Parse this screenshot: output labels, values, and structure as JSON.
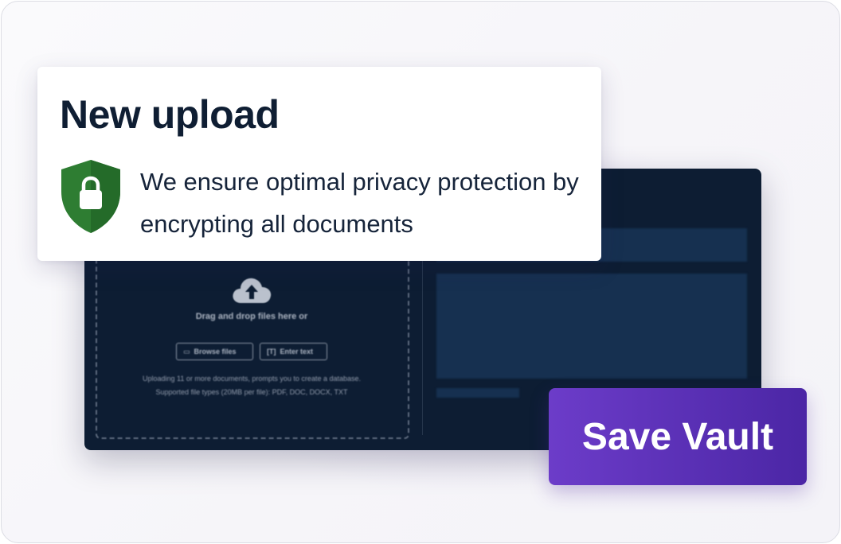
{
  "card": {
    "title": "New upload",
    "description": "We ensure optimal privacy protection by encrypting all documents",
    "icon": "shield-lock-icon",
    "shield_color": "#2e7d32"
  },
  "dropzone": {
    "title": "Drag and drop files here or",
    "browse_label": "Browse files",
    "enter_text_label": "Enter text",
    "note_line1": "Uploading 11 or more documents, prompts you to create a database.",
    "note_line2": "Supported file types (20MB per file): PDF, DOC, DOCX, TXT",
    "icon": "cloud-upload-icon"
  },
  "actions": {
    "save_label": "Save Vault"
  },
  "colors": {
    "panel_bg": "#0d1d33",
    "accent_start": "#6c3cc9",
    "accent_end": "#4b26a5",
    "title_text": "#0f1e33"
  }
}
